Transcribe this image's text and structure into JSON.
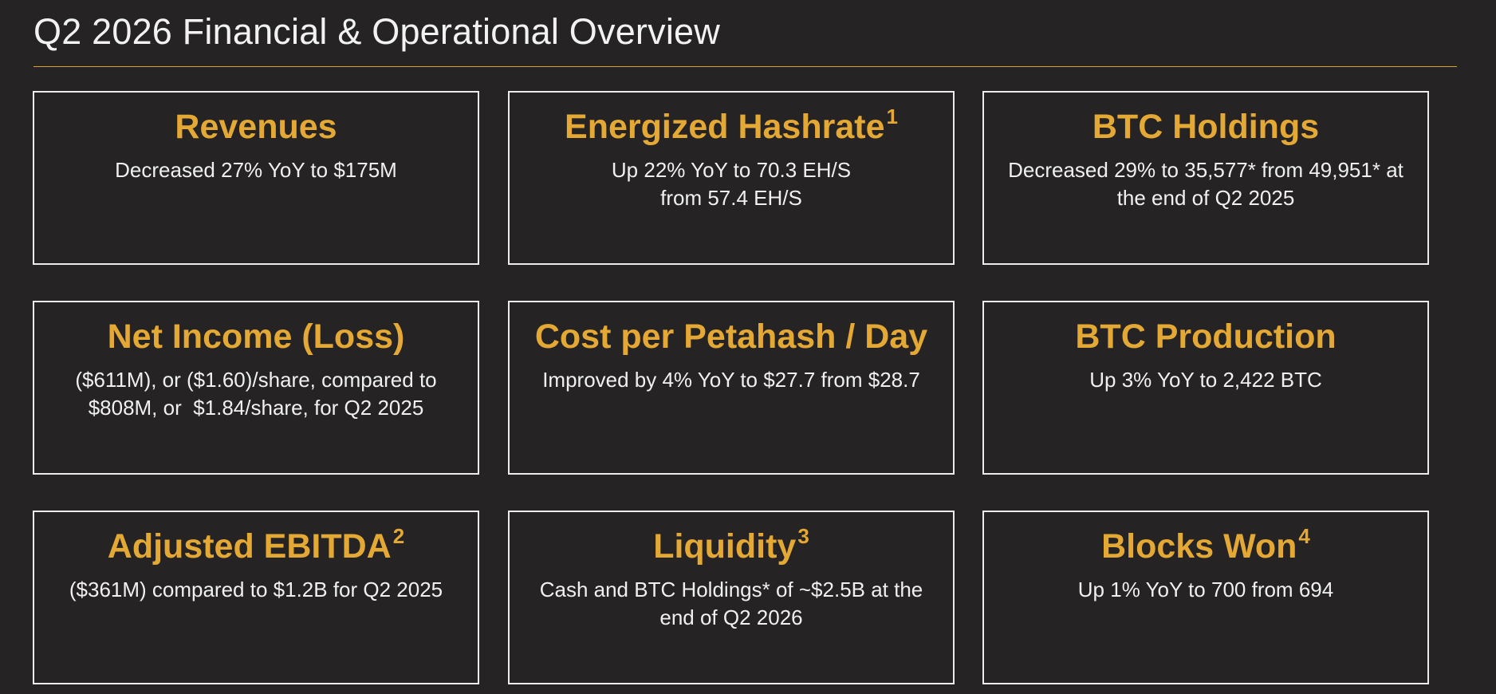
{
  "title": "Q2 2026 Financial & Operational Overview",
  "colors": {
    "background": "#252324",
    "accent": "#e4a834",
    "rule": "#d9a334",
    "text": "#f0f0f0",
    "card_border": "#ececec"
  },
  "cards": [
    {
      "heading": "Revenues",
      "footnote": "",
      "lines": [
        "Decreased 27% YoY to $175M"
      ]
    },
    {
      "heading": "Energized Hashrate",
      "footnote": "1",
      "lines": [
        "Up 22% YoY to 70.3 EH/S",
        "from 57.4 EH/S"
      ]
    },
    {
      "heading": "BTC Holdings",
      "footnote": "",
      "lines": [
        "Decreased 29% to 35,577* from 49,951* at",
        "the end of Q2 2025"
      ]
    },
    {
      "heading": "Net Income (Loss)",
      "footnote": "",
      "lines": [
        "($611M), or ($1.60)/share, compared to",
        "$808M, or  $1.84/share, for Q2 2025"
      ]
    },
    {
      "heading": "Cost per Petahash / Day",
      "footnote": "",
      "lines": [
        "Improved by 4% YoY to $27.7 from $28.7"
      ]
    },
    {
      "heading": "BTC Production",
      "footnote": "",
      "lines": [
        "Up 3% YoY to 2,422 BTC"
      ]
    },
    {
      "heading": "Adjusted EBITDA",
      "footnote": "2",
      "lines": [
        "($361M) compared to $1.2B for Q2 2025"
      ]
    },
    {
      "heading": "Liquidity",
      "footnote": "3",
      "lines": [
        "Cash and BTC Holdings* of ~$2.5B at the",
        "end of Q2 2026"
      ]
    },
    {
      "heading": "Blocks Won",
      "footnote": "4",
      "lines": [
        "Up 1% YoY to 700 from 694"
      ]
    }
  ]
}
